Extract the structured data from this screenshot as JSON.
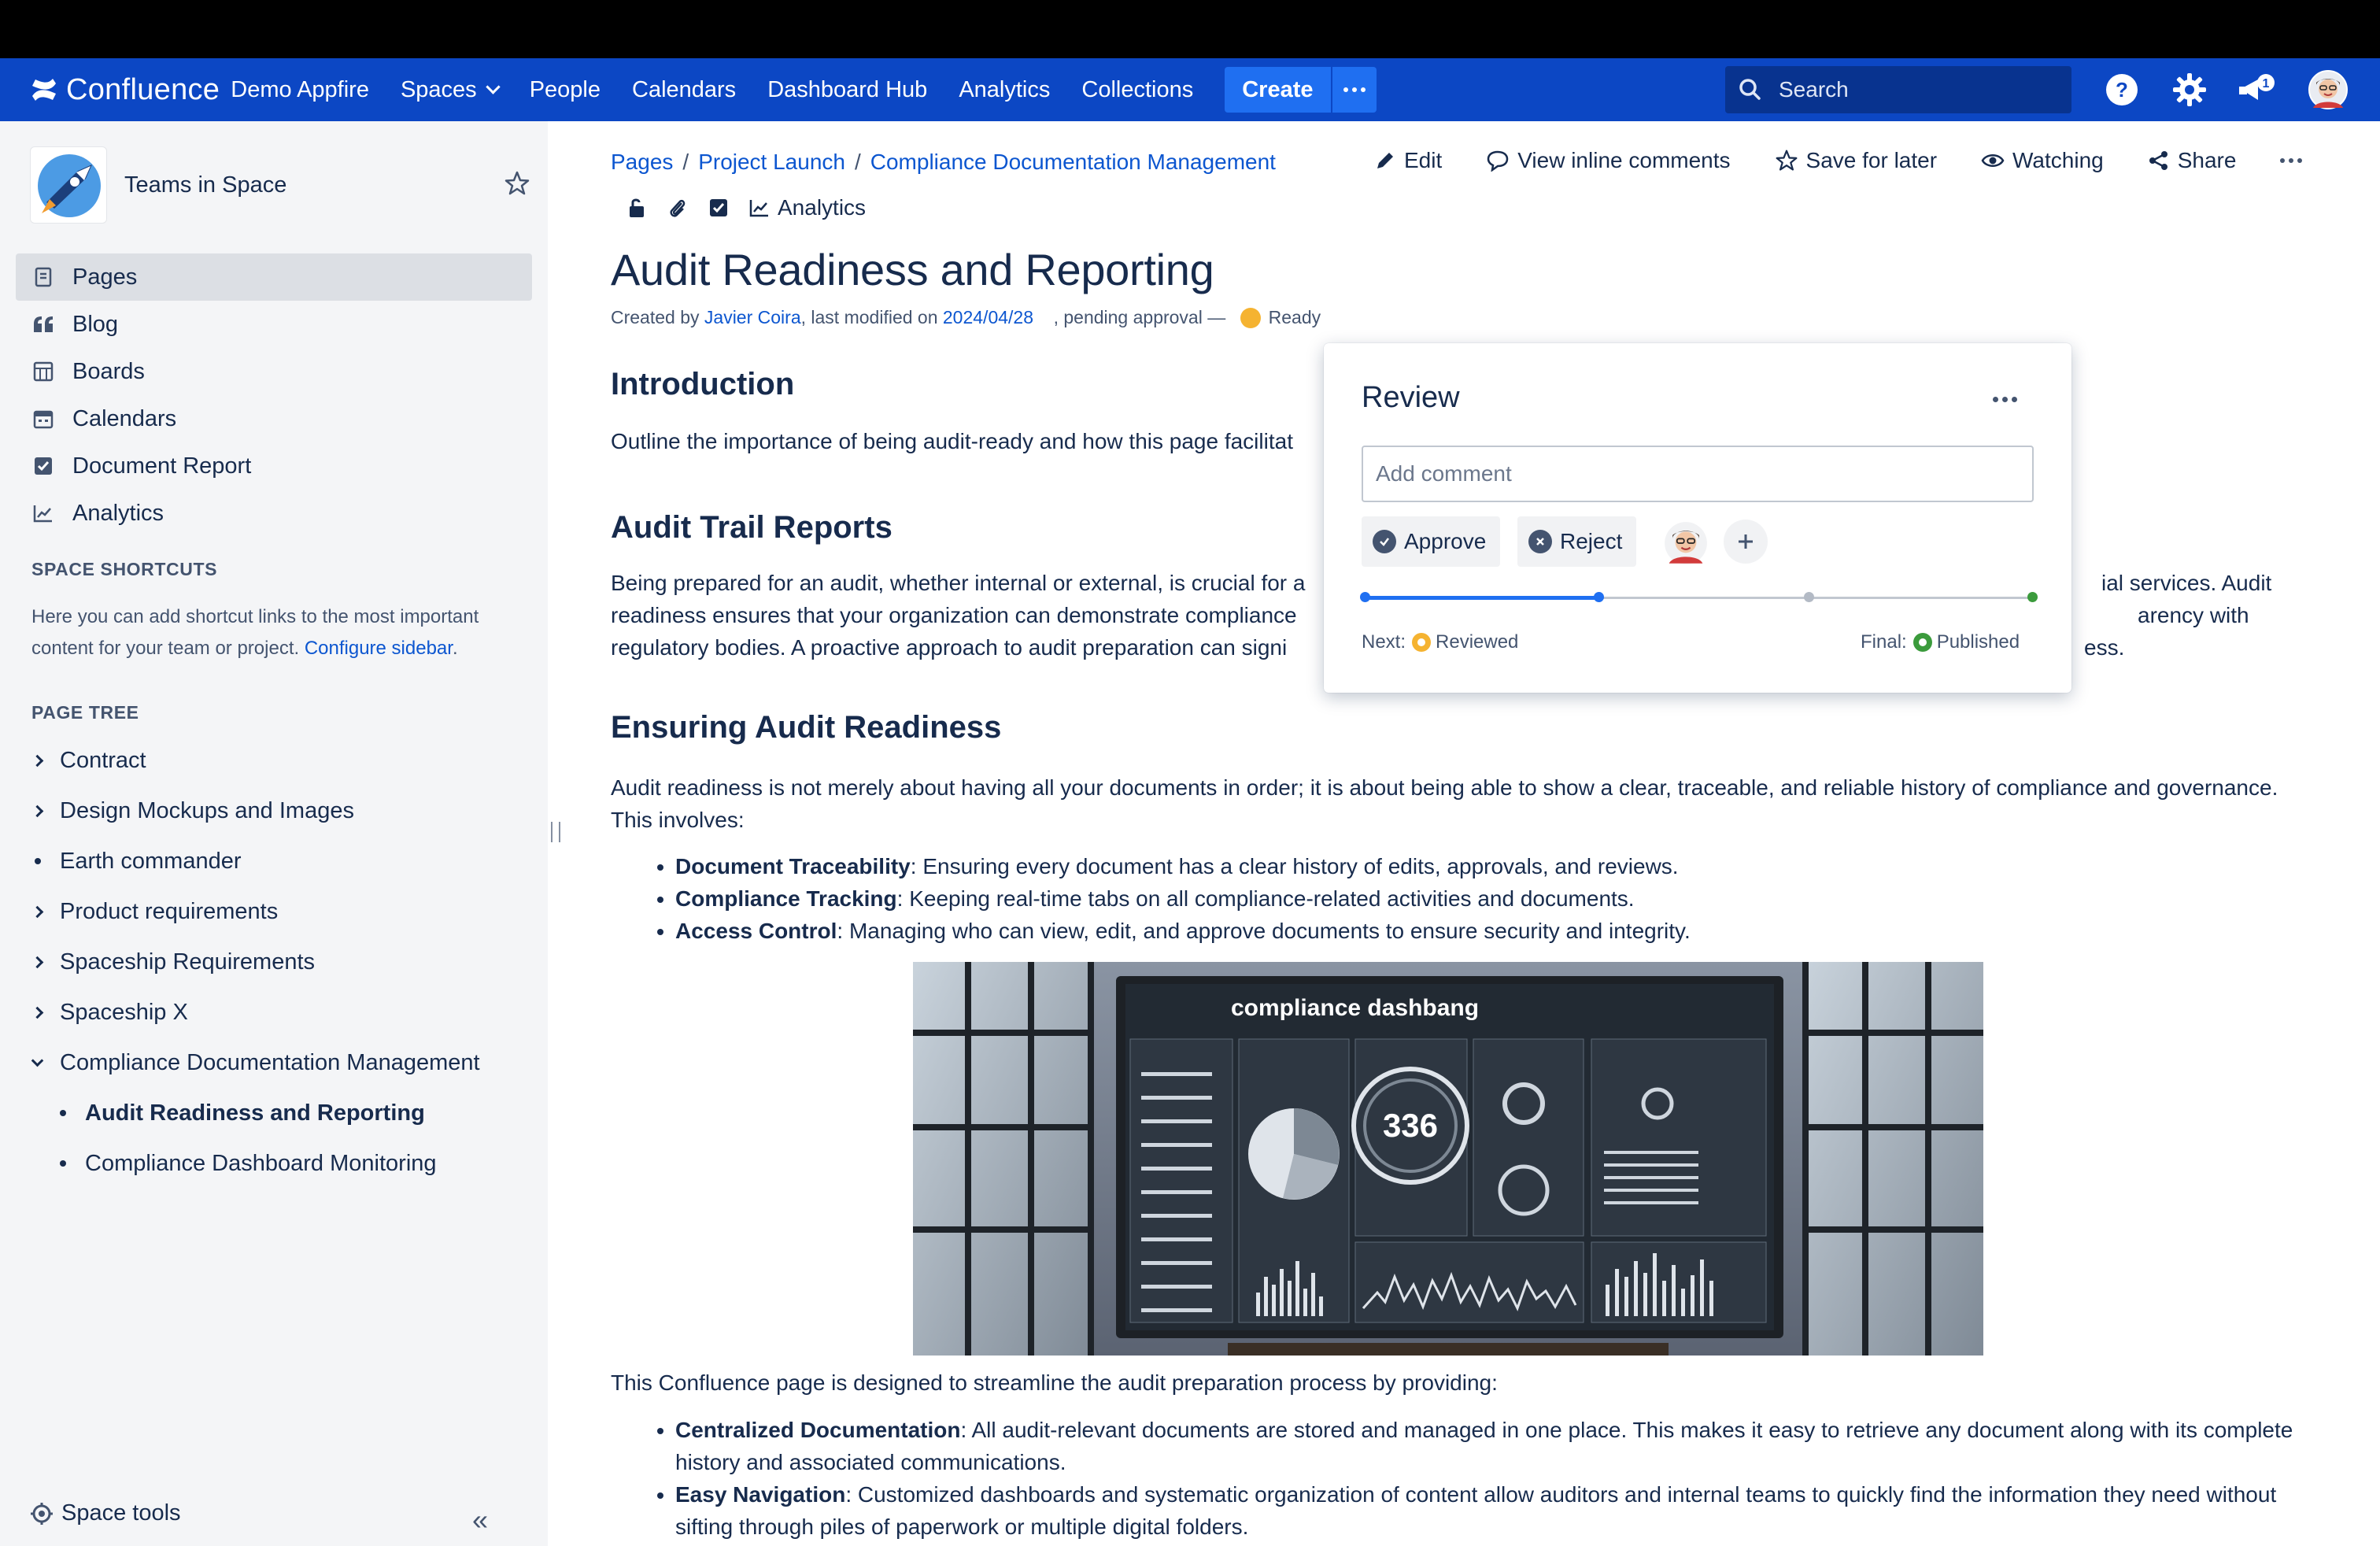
{
  "app": {
    "product": "Confluence",
    "site_name": "Demo Appfire",
    "colors": {
      "nav": "#0c47c4",
      "accent": "#1f6ff1",
      "link": "#0c56d0",
      "ready": "#f5b331",
      "published": "#3b9b3c"
    }
  },
  "nav": {
    "items": [
      "Spaces",
      "People",
      "Calendars",
      "Dashboard Hub",
      "Analytics",
      "Collections"
    ],
    "create_label": "Create",
    "search_placeholder": "Search",
    "notification_count": "1",
    "icons": [
      "help-icon",
      "settings-icon",
      "notifications-icon",
      "profile-avatar"
    ]
  },
  "sidebar": {
    "space_name": "Teams in Space",
    "items": [
      "Pages",
      "Blog",
      "Boards",
      "Calendars",
      "Document Report",
      "Analytics"
    ],
    "active_item": "Pages",
    "shortcuts_heading": "SPACE SHORTCUTS",
    "shortcuts_text": "Here you can add shortcut links to the most important content for your team or project. ",
    "configure_link": "Configure sidebar",
    "shortcuts_tail": ".",
    "tree_heading": "PAGE TREE",
    "tree": [
      "Contract",
      "Design Mockups and Images",
      "Earth commander",
      "Product requirements",
      "Spaceship Requirements",
      "Spaceship X",
      "Compliance Documentation Management"
    ],
    "tree_children": [
      "Audit Readiness and Reporting",
      "Compliance Dashboard Monitoring"
    ],
    "space_tools": "Space tools"
  },
  "page": {
    "breadcrumb": [
      "Pages",
      "Project Launch",
      "Compliance Documentation Management"
    ],
    "actions": {
      "edit": "Edit",
      "inline_comments": "View inline comments",
      "save": "Save for later",
      "watch": "Watching",
      "share": "Share"
    },
    "analytics_label": "Analytics",
    "title": "Audit Readiness and Reporting",
    "byline_prefix": "Created by ",
    "author": "Javier Coira",
    "byline_mid": ", last modified on ",
    "date": "2024/04/28",
    "byline_pending": "    , pending approval — ",
    "status": "Ready",
    "sections": {
      "intro_heading": "Introduction",
      "intro_text": "Outline the importance of being audit-ready and how this page facilitat",
      "trail_heading": "Audit Trail Reports",
      "trail_lines": [
        "Being prepared for an audit, whether internal or external, is crucial for a",
        "readiness ensures that your organization can demonstrate compliance",
        "regulatory bodies. A proactive approach to audit preparation can signi"
      ],
      "trail_right": [
        "ial services. Audit",
        "arency with",
        "ess."
      ],
      "readiness_heading": "Ensuring Audit Readiness",
      "readiness_text": "Audit readiness is not merely about having all your documents in order; it is about being able to show a clear, traceable, and reliable history of compliance and governance. This involves:",
      "bullets1": [
        {
          "term": "Document Traceability",
          "text": ": Ensuring every document has a clear history of edits, approvals, and reviews."
        },
        {
          "term": "Compliance Tracking",
          "text": ": Keeping real-time tabs on all compliance-related activities and documents."
        },
        {
          "term": "Access Control",
          "text": ": Managing who can view, edit, and approve documents to ensure security and integrity."
        }
      ],
      "hero_caption": "compliance dashbang",
      "hero_number": "336",
      "after_image": "This Confluence page is designed to streamline the audit preparation process by providing:",
      "bullets2": [
        {
          "term": "Centralized Documentation",
          "text": ": All audit-relevant documents are stored and managed in one place. This makes it easy to retrieve any document along with its complete history and associated communications."
        },
        {
          "term": "Easy Navigation",
          "text": ": Customized dashboards and systematic organization of content allow auditors and internal teams to quickly find the information they need without sifting through piles of paperwork or multiple digital folders."
        }
      ]
    }
  },
  "review": {
    "title": "Review",
    "comment_placeholder": "Add comment",
    "approve": "Approve",
    "reject": "Reject",
    "next_label": "Next:",
    "next_state": "Reviewed",
    "final_label": "Final:",
    "final_state": "Published",
    "progress": 0.35
  }
}
